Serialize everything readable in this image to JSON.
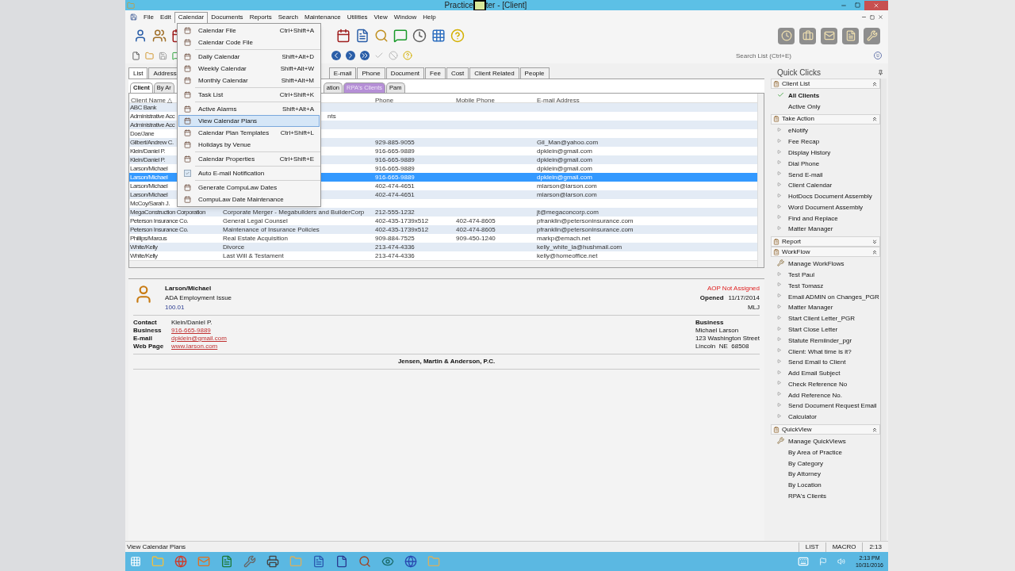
{
  "window": {
    "title_start": "Practice",
    "title_end": "ter - [Client]"
  },
  "menu_bar": [
    {
      "label": "File",
      "selected": false
    },
    {
      "label": "Edit",
      "selected": false
    },
    {
      "label": "Calendar",
      "selected": true
    },
    {
      "label": "Documents",
      "selected": false
    },
    {
      "label": "Reports",
      "selected": false
    },
    {
      "label": "Search",
      "selected": false
    },
    {
      "label": "Maintenance",
      "selected": false
    },
    {
      "label": "Utilities",
      "selected": false
    },
    {
      "label": "View",
      "selected": false
    },
    {
      "label": "Window",
      "selected": false
    },
    {
      "label": "Help",
      "selected": false
    }
  ],
  "calendar_menu": [
    {
      "label": "Calendar File",
      "shortcut": "Ctrl+Shift+A",
      "selected": false,
      "checked": false,
      "separator_after": false
    },
    {
      "label": "Calendar Code File",
      "selected": false,
      "checked": false,
      "separator_after": true
    },
    {
      "label": "Daily Calendar",
      "shortcut": "Shift+Alt+D",
      "selected": false,
      "checked": false,
      "separator_after": false
    },
    {
      "label": "Weekly Calendar",
      "shortcut": "Shift+Alt+W",
      "selected": false,
      "checked": false,
      "separator_after": false
    },
    {
      "label": "Monthly Calendar",
      "shortcut": "Shift+Alt+M",
      "selected": false,
      "checked": false,
      "separator_after": true
    },
    {
      "label": "Task List",
      "shortcut": "Ctrl+Shift+K",
      "selected": false,
      "checked": false,
      "separator_after": true
    },
    {
      "label": "Active Alarms",
      "shortcut": "Shift+Alt+A",
      "selected": false,
      "checked": false,
      "separator_after": false
    },
    {
      "label": "View Calendar Plans",
      "selected": true,
      "checked": false,
      "separator_after": false
    },
    {
      "label": "Calendar Plan Templates",
      "shortcut": "Ctrl+Shift+L",
      "selected": false,
      "checked": false,
      "separator_after": false
    },
    {
      "label": "Holidays by Venue",
      "selected": false,
      "checked": false,
      "separator_after": true
    },
    {
      "label": "Calendar Properties",
      "shortcut": "Ctrl+Shift+E",
      "selected": false,
      "checked": false,
      "separator_after": true
    },
    {
      "label": "Auto E-mail Notification",
      "selected": false,
      "checked": true,
      "separator_after": true
    },
    {
      "label": "Generate CompuLaw Dates",
      "selected": false,
      "checked": false,
      "separator_after": false
    },
    {
      "label": "CompuLaw Date Maintenance",
      "selected": false,
      "checked": false,
      "separator_after": false
    }
  ],
  "search": {
    "placeholder": "Search List (Ctrl+E)"
  },
  "tabs_left": [
    {
      "label": "List",
      "selected": true
    },
    {
      "label": "Address",
      "selected": false
    }
  ],
  "tabs_right": [
    {
      "label": "E-mail",
      "selected": false
    },
    {
      "label": "Phone",
      "selected": false
    },
    {
      "label": "Document",
      "selected": false
    },
    {
      "label": "Fee",
      "selected": false
    },
    {
      "label": "Cost",
      "selected": false
    },
    {
      "label": "Client Related",
      "selected": false
    },
    {
      "label": "People",
      "selected": false
    }
  ],
  "subtabs_left": [
    {
      "label": "Client",
      "selected": true
    },
    {
      "label": "By Ar",
      "selected": false
    }
  ],
  "subtabs_right": [
    {
      "label": "ation",
      "selected": false
    },
    {
      "label": "RPA's Clients",
      "selected": false,
      "color": "#b58fd6"
    },
    {
      "label": "Pam",
      "selected": false
    }
  ],
  "table": {
    "headers": {
      "client_name": "Client Name △",
      "phone": "Phone",
      "mobile_phone": "Mobile Phone",
      "email_address": "E-mail Address"
    },
    "rows": [
      {
        "client_name": "ABC Bank",
        "selected": false
      },
      {
        "client_name": "Administrative Acc",
        "column_2_tail": "nts",
        "selected": false
      },
      {
        "client_name": "Administrative Acc",
        "selected": false
      },
      {
        "client_name": "Doe/Jane",
        "selected": false
      },
      {
        "client_name": "Gilbert/Andrew C.",
        "phone": "929-885-9055",
        "email_address": "Gil_Man@yahoo.com",
        "selected": false
      },
      {
        "client_name": "Klein/Daniel P.",
        "phone": "916-665-9889",
        "email_address": "dpklein@gmail.com",
        "selected": false
      },
      {
        "client_name": "Klein/Daniel P.",
        "phone": "916-665-9889",
        "email_address": "dpklein@gmail.com",
        "selected": false
      },
      {
        "client_name": "Larson/Michael",
        "phone": "916-665-9889",
        "email_address": "dpklein@gmail.com",
        "selected": false
      },
      {
        "client_name": "Larson/Michael",
        "phone": "916-665-9889",
        "email_address": "dpklein@gmail.com",
        "selected": true
      },
      {
        "client_name": "Larson/Michael",
        "phone": "402-474-4651",
        "email_address": "mlarson@larson.com",
        "selected": false
      },
      {
        "client_name": "Larson/Michael",
        "phone": "402-474-4651",
        "email_address": "mlarson@larson.com",
        "selected": false
      },
      {
        "client_name": "McCoy/Sarah J.",
        "selected": false
      },
      {
        "client_name": "MegaConstruction Corporation",
        "column_2": "Corporate Merger - Megabuilders and BuilderCorp",
        "phone": "212-555-1232",
        "email_address": "jt@megaconcorp.com",
        "selected": false
      },
      {
        "client_name": "Peterson Insurance Co.",
        "column_2": "General Legal Counsel",
        "phone": "402-435-1739x512",
        "mobile_phone": "402-474-8605",
        "email_address": "pfranklin@petersoninsurance.com",
        "selected": false
      },
      {
        "client_name": "Peterson Insurance Co.",
        "column_2": "Maintenance of Insurance Policies",
        "phone": "402-435-1739x512",
        "mobile_phone": "402-474-8605",
        "email_address": "pfranklin@petersoninsurance.com",
        "selected": false
      },
      {
        "client_name": "Phillips/Marcus",
        "column_2": "Real Estate Acquisition",
        "phone": "909-884-7525",
        "mobile_phone": "909-450-1240",
        "email_address": "markp@emach.net",
        "selected": false
      },
      {
        "client_name": "White/Kelly",
        "column_2": "Divorce",
        "phone": "213-474-4336",
        "email_address": "kelly_white_la@hushmail.com",
        "selected": false
      },
      {
        "client_name": "White/Kelly",
        "column_2": "Last Will & Testament",
        "phone": "213-474-4336",
        "email_address": "kelly@homeoffice.net",
        "selected": false
      }
    ]
  },
  "detail": {
    "client": "Larson/Michael",
    "matter": "ADA Employment Issue",
    "number": "100.01",
    "aop": "AOP Not Assigned",
    "opened_label": "Opened",
    "opened": "11/17/2014",
    "initials": "MLJ",
    "contact_rows": [
      {
        "label": "Contact",
        "value": "Klein/Daniel P.",
        "kind": "text"
      },
      {
        "label": "Business",
        "value": "916-665-9889",
        "kind": "link"
      },
      {
        "label": "E-mail",
        "value": "dpklein@gmail.com",
        "kind": "link"
      },
      {
        "label": "Web Page",
        "value": "www.larson.com",
        "kind": "link"
      }
    ],
    "address_title": "Business",
    "address_lines": [
      "Michael Larson",
      "123 Washington Street",
      "Lincoln  NE  68508"
    ],
    "firm": "Jensen, Martin & Anderson, P.C."
  },
  "quick_clicks": {
    "title": "Quick Clicks",
    "sections": [
      {
        "title": "Client List",
        "expanded": true,
        "items": [
          {
            "label": "All Clients",
            "kind": "check",
            "selected": true
          },
          {
            "label": "Active Only",
            "kind": "plain",
            "selected": false
          }
        ]
      },
      {
        "title": "Take Action",
        "expanded": true,
        "items": [
          {
            "label": "eNotify",
            "kind": "arrow"
          },
          {
            "label": "Fee Recap",
            "kind": "arrow"
          },
          {
            "label": "Display History",
            "kind": "arrow"
          },
          {
            "label": "Dial Phone",
            "kind": "arrow"
          },
          {
            "label": "Send E-mail",
            "kind": "arrow"
          },
          {
            "label": "Client Calendar",
            "kind": "arrow"
          },
          {
            "label": "HotDocs Document Assembly",
            "kind": "arrow"
          },
          {
            "label": "Word Document Assembly",
            "kind": "arrow"
          },
          {
            "label": "Find and Replace",
            "kind": "arrow"
          },
          {
            "label": "Matter Manager",
            "kind": "arrow"
          }
        ]
      },
      {
        "title": "Report",
        "expanded": false
      },
      {
        "title": "WorkFlow",
        "expanded": true,
        "items": [
          {
            "label": "Manage WorkFlows",
            "kind": "tool"
          },
          {
            "label": "Test Paul",
            "kind": "arrow"
          },
          {
            "label": "Test Tomasz",
            "kind": "arrow"
          },
          {
            "label": "Email ADMIN on Changes_PGR",
            "kind": "arrow"
          },
          {
            "label": "Matter Manager",
            "kind": "arrow"
          },
          {
            "label": "Start Client Letter_PGR",
            "kind": "arrow"
          },
          {
            "label": "Start Close Letter",
            "kind": "arrow"
          },
          {
            "label": "Statute Remiinder_pgr",
            "kind": "arrow"
          },
          {
            "label": "Client:  What time is it?",
            "kind": "arrow"
          },
          {
            "label": "Send Email to Client",
            "kind": "arrow"
          },
          {
            "label": "Add Email Subject",
            "kind": "arrow"
          },
          {
            "label": "Check Reference No",
            "kind": "arrow"
          },
          {
            "label": "Add Reference No.",
            "kind": "arrow"
          },
          {
            "label": "Send Document Request Email",
            "kind": "arrow"
          },
          {
            "label": "Calculator",
            "kind": "arrow"
          }
        ]
      },
      {
        "title": "QuickView",
        "expanded": true,
        "items": [
          {
            "label": "Manage QuickViews",
            "kind": "tool"
          },
          {
            "label": "By Area of Practice",
            "kind": "plain"
          },
          {
            "label": "By Category",
            "kind": "plain"
          },
          {
            "label": "By Attorney",
            "kind": "plain"
          },
          {
            "label": "By Location",
            "kind": "plain"
          },
          {
            "label": "RPA's Clients",
            "kind": "plain"
          }
        ]
      }
    ]
  },
  "status_bar": {
    "message": "View Calendar Plans",
    "panels": [
      "LIST",
      "MACRO",
      "2:13"
    ]
  },
  "taskbar": {
    "time": "2:13 PM",
    "date": "10/31/2016"
  }
}
